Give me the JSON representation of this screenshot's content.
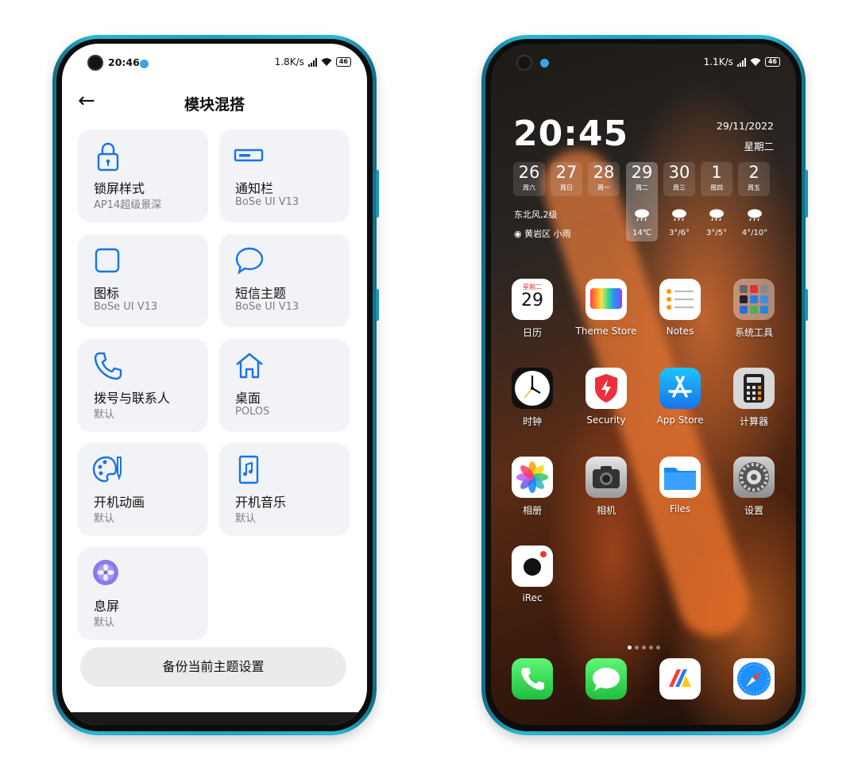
{
  "left_phone": {
    "status": {
      "time": "20:46",
      "speed": "1.8K/s",
      "battery": "46"
    },
    "header": {
      "title": "模块混搭",
      "back_icon": "arrow-left-icon"
    },
    "modules": [
      {
        "name": "锁屏样式",
        "value": "AP14超级景深",
        "icon": "lock-icon"
      },
      {
        "name": "通知栏",
        "value": "BoSe UI V13",
        "icon": "notification-bar-icon"
      },
      {
        "name": "图标",
        "value": "BoSe UI V13",
        "icon": "square-icon"
      },
      {
        "name": "短信主题",
        "value": "BoSe UI V13",
        "icon": "message-bubble-icon"
      },
      {
        "name": "拨号与联系人",
        "value": "默认",
        "icon": "phone-icon"
      },
      {
        "name": "桌面",
        "value": "POLOS",
        "icon": "home-icon"
      },
      {
        "name": "开机动画",
        "value": "默认",
        "icon": "palette-icon"
      },
      {
        "name": "开机音乐",
        "value": "默认",
        "icon": "music-file-icon"
      },
      {
        "name": "息屏",
        "value": "默认",
        "icon": "flower-icon"
      }
    ],
    "backup_button": "备份当前主题设置",
    "accent": "#1a73e8"
  },
  "right_phone": {
    "status": {
      "speed": "1.1K/s",
      "battery": "46"
    },
    "clock": {
      "time": "20:45",
      "date": "29/11/2022",
      "weekday": "星期二"
    },
    "forecast": [
      {
        "day": "26",
        "label": "周六"
      },
      {
        "day": "27",
        "label": "周日"
      },
      {
        "day": "28",
        "label": "周一"
      },
      {
        "day": "29",
        "label": "周二"
      },
      {
        "day": "30",
        "label": "周三"
      },
      {
        "day": "1",
        "label": "周四"
      },
      {
        "day": "2",
        "label": "周五"
      }
    ],
    "weather": {
      "wind": "东北风,2级",
      "location": "黄岩区 小雨",
      "temps": [
        "14℃",
        "3°/6°",
        "3°/5°",
        "4°/10°"
      ]
    },
    "calendar_tile": {
      "weekday": "星期二",
      "day": "29"
    },
    "apps": [
      {
        "label": "日历",
        "icon": "calendar-icon"
      },
      {
        "label": "Theme Store",
        "icon": "theme-store-icon"
      },
      {
        "label": "Notes",
        "icon": "notes-icon"
      },
      {
        "label": "系统工具",
        "icon": "folder-icon"
      },
      {
        "label": "时钟",
        "icon": "clock-icon"
      },
      {
        "label": "Security",
        "icon": "security-shield-icon"
      },
      {
        "label": "App Store",
        "icon": "app-store-icon"
      },
      {
        "label": "计算器",
        "icon": "calculator-icon"
      },
      {
        "label": "相册",
        "icon": "photos-icon"
      },
      {
        "label": "相机",
        "icon": "camera-icon"
      },
      {
        "label": "Files",
        "icon": "files-folder-icon"
      },
      {
        "label": "设置",
        "icon": "settings-gear-icon"
      },
      {
        "label": "iRec",
        "icon": "irec-icon"
      }
    ],
    "dock": [
      {
        "icon": "phone-call-icon"
      },
      {
        "icon": "messages-icon"
      },
      {
        "icon": "vivo-app-icon"
      },
      {
        "icon": "safari-compass-icon"
      }
    ],
    "page_indicator": {
      "pages": 5,
      "current": 1
    }
  }
}
